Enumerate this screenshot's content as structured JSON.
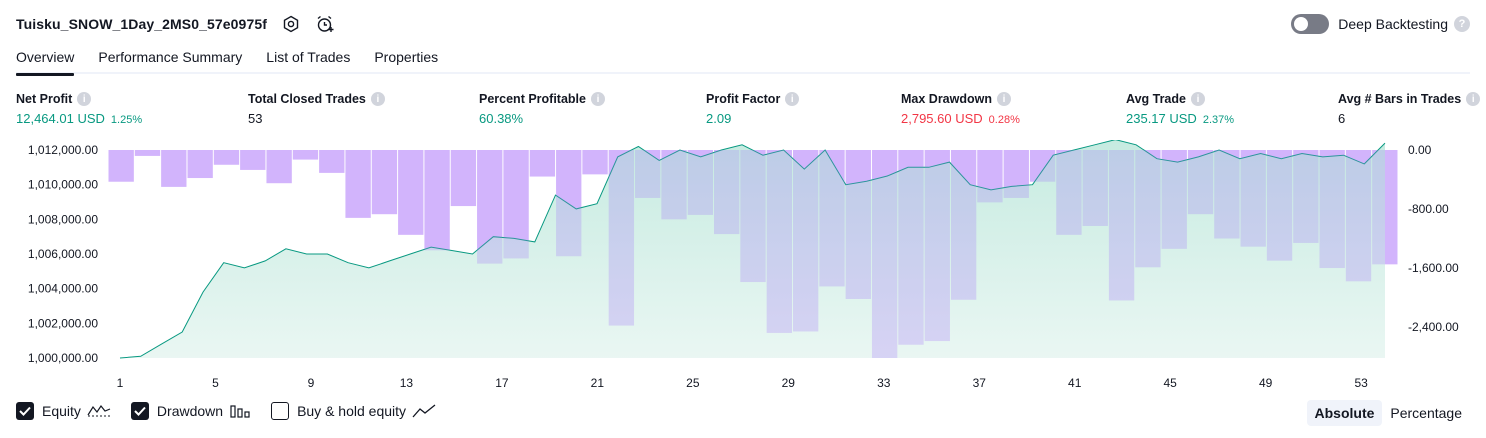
{
  "header": {
    "strategy_name": "Tuisku_SNOW_1Day_2MS0_57e0975f",
    "settings_icon": "gear-icon",
    "alert_icon": "alarm-add-icon"
  },
  "deep_backtesting": {
    "label": "Deep Backtesting",
    "enabled": false,
    "help_icon": "question-icon"
  },
  "tabs": [
    {
      "label": "Overview",
      "active": true
    },
    {
      "label": "Performance Summary",
      "active": false
    },
    {
      "label": "List of Trades",
      "active": false
    },
    {
      "label": "Properties",
      "active": false
    }
  ],
  "metrics": [
    {
      "label": "Net Profit",
      "value": "12,464.01 USD",
      "pct": "1.25%",
      "color": "#089981"
    },
    {
      "label": "Total Closed Trades",
      "value": "53",
      "pct": "",
      "color": "#131722"
    },
    {
      "label": "Percent Profitable",
      "value": "60.38%",
      "pct": "",
      "color": "#089981"
    },
    {
      "label": "Profit Factor",
      "value": "2.09",
      "pct": "",
      "color": "#089981"
    },
    {
      "label": "Max Drawdown",
      "value": "2,795.60 USD",
      "pct": "0.28%",
      "color": "#f23645"
    },
    {
      "label": "Avg Trade",
      "value": "235.17 USD",
      "pct": "2.37%",
      "color": "#089981"
    },
    {
      "label": "Avg # Bars in Trades",
      "value": "6",
      "pct": "",
      "color": "#131722"
    }
  ],
  "chart_data": {
    "type": "area",
    "x_ticks": [
      "1",
      "5",
      "9",
      "13",
      "17",
      "21",
      "25",
      "29",
      "33",
      "37",
      "41",
      "45",
      "49",
      "53"
    ],
    "y_left_ticks": [
      "1,000,000.00",
      "1,002,000.00",
      "1,004,000.00",
      "1,006,000.00",
      "1,008,000.00",
      "1,010,000.00",
      "1,012,000.00"
    ],
    "y_left_range": [
      1000000,
      1012000
    ],
    "y_right_ticks": [
      "0.00",
      "-800.00",
      "-1,600.00",
      "-2,400.00"
    ],
    "y_right_range": [
      -2820,
      0
    ],
    "x": [
      1,
      54
    ],
    "series": [
      {
        "name": "Equity",
        "color": "#089981",
        "values": [
          1000000,
          1000100,
          1000800,
          1001500,
          1003800,
          1005500,
          1005200,
          1005600,
          1006300,
          1006000,
          1006000,
          1005500,
          1005200,
          1005600,
          1006000,
          1006400,
          1006200,
          1006000,
          1007000,
          1006900,
          1006700,
          1009400,
          1008600,
          1008900,
          1011600,
          1012200,
          1011400,
          1012000,
          1011600,
          1012000,
          1012300,
          1011700,
          1012000,
          1010900,
          1012000,
          1010000,
          1010200,
          1010500,
          1011000,
          1011000,
          1011300,
          1010000,
          1009700,
          1009900,
          1010000,
          1011700,
          1012000,
          1012300,
          1012600,
          1012300,
          1011500,
          1011300,
          1011600,
          1012000,
          1011500,
          1011800,
          1011500,
          1011800,
          1011600,
          1011700,
          1011200,
          1012400
        ]
      },
      {
        "name": "Drawdown",
        "color": "#b388ff",
        "values": [
          -430,
          -80,
          -500,
          -380,
          -200,
          -270,
          -450,
          -130,
          -310,
          -920,
          -870,
          -1150,
          -1360,
          -760,
          -1540,
          -1470,
          -360,
          -1440,
          -330,
          -2380,
          -650,
          -940,
          -880,
          -1140,
          -1790,
          -2480,
          -2460,
          -1850,
          -2020,
          -2820,
          -2640,
          -2590,
          -2030,
          -710,
          -650,
          -430,
          -1150,
          -1030,
          -2040,
          -1590,
          -1340,
          -870,
          -1200,
          -1310,
          -1500,
          -1260,
          -1600,
          -1780,
          -1550
        ]
      }
    ],
    "grid": false
  },
  "legend": [
    {
      "label": "Equity",
      "checked": true,
      "icon": "equity-line-icon"
    },
    {
      "label": "Drawdown",
      "checked": true,
      "icon": "bars-icon"
    },
    {
      "label": "Buy & hold equity",
      "checked": false,
      "icon": "trend-line-icon"
    }
  ],
  "modes": [
    {
      "label": "Absolute",
      "active": true
    },
    {
      "label": "Percentage",
      "active": false
    }
  ]
}
